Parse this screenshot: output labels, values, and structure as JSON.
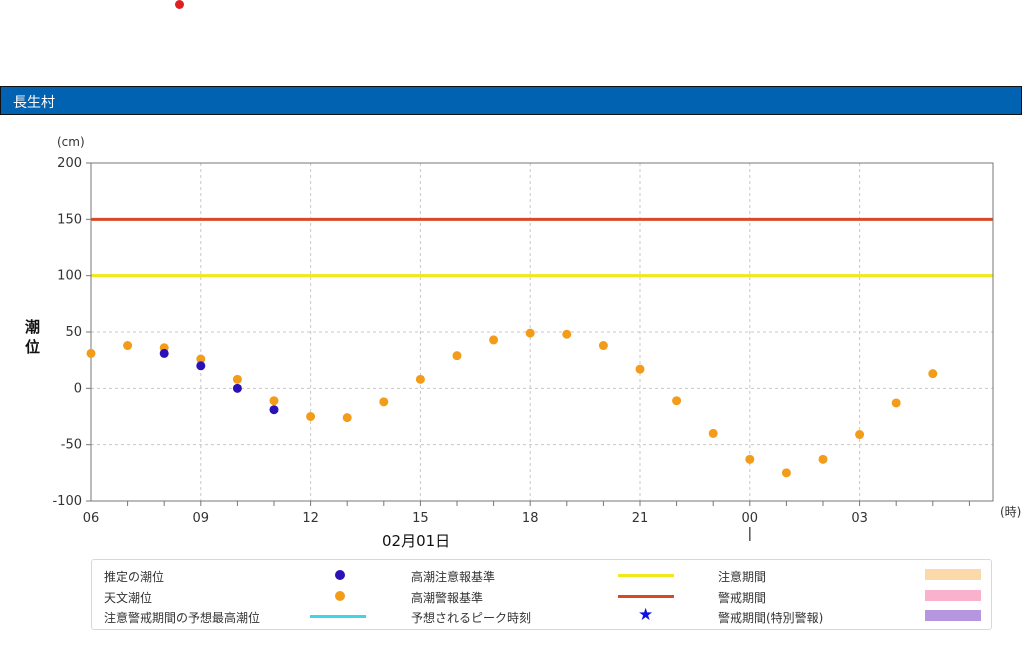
{
  "station": {
    "name": "長生村"
  },
  "chart_data": {
    "type": "scatter",
    "y_unit": "(cm)",
    "ylabel": "潮位",
    "x_unit": "(時)",
    "ylim": [
      -100,
      200
    ],
    "yticks": [
      -100,
      -50,
      0,
      50,
      100,
      150,
      200
    ],
    "x_ticks": [
      "09",
      "12",
      "15",
      "18",
      "21",
      "00",
      "03",
      "06"
    ],
    "date_label": "02月01日",
    "grid": true,
    "thresholds": [
      {
        "name": "高潮注意報基準",
        "value": 100,
        "color": "#f0e81a"
      },
      {
        "name": "高潮警報基準",
        "value": 150,
        "color": "#d84a24"
      }
    ],
    "series": [
      {
        "name": "天文潮位",
        "color": "#f39c1a",
        "x": [
          "07",
          "08",
          "09",
          "10",
          "11",
          "12",
          "13",
          "14",
          "15",
          "16",
          "17",
          "18",
          "19",
          "20",
          "21",
          "22",
          "23",
          "00",
          "01",
          "02",
          "03",
          "04",
          "05",
          "06"
        ],
        "values": [
          38,
          36,
          26,
          8,
          -11,
          -25,
          -26,
          -12,
          8,
          29,
          43,
          49,
          48,
          38,
          17,
          -11,
          -40,
          -63,
          -75,
          -63,
          -41,
          -13,
          13,
          31
        ]
      },
      {
        "name": "推定の潮位",
        "color": "#2a12b8",
        "x": [
          "08",
          "09",
          "10",
          "11"
        ],
        "values": [
          31,
          20,
          0,
          -19
        ]
      }
    ]
  },
  "legend": {
    "items": [
      {
        "label": "推定の潮位"
      },
      {
        "label": "高潮注意報基準"
      },
      {
        "label": "注意期間",
        "color": "#fbd9ab"
      },
      {
        "label": "天文潮位"
      },
      {
        "label": "高潮警報基準"
      },
      {
        "label": "警戒期間",
        "color": "#f9b1cc"
      },
      {
        "label": "注意警戒期間の予想最高潮位",
        "color": "#3cd6e6"
      },
      {
        "label": "予想されるピーク時刻",
        "icon": "star-icon"
      },
      {
        "label": "警戒期間(特別警報)",
        "color": "#b596df"
      }
    ]
  }
}
